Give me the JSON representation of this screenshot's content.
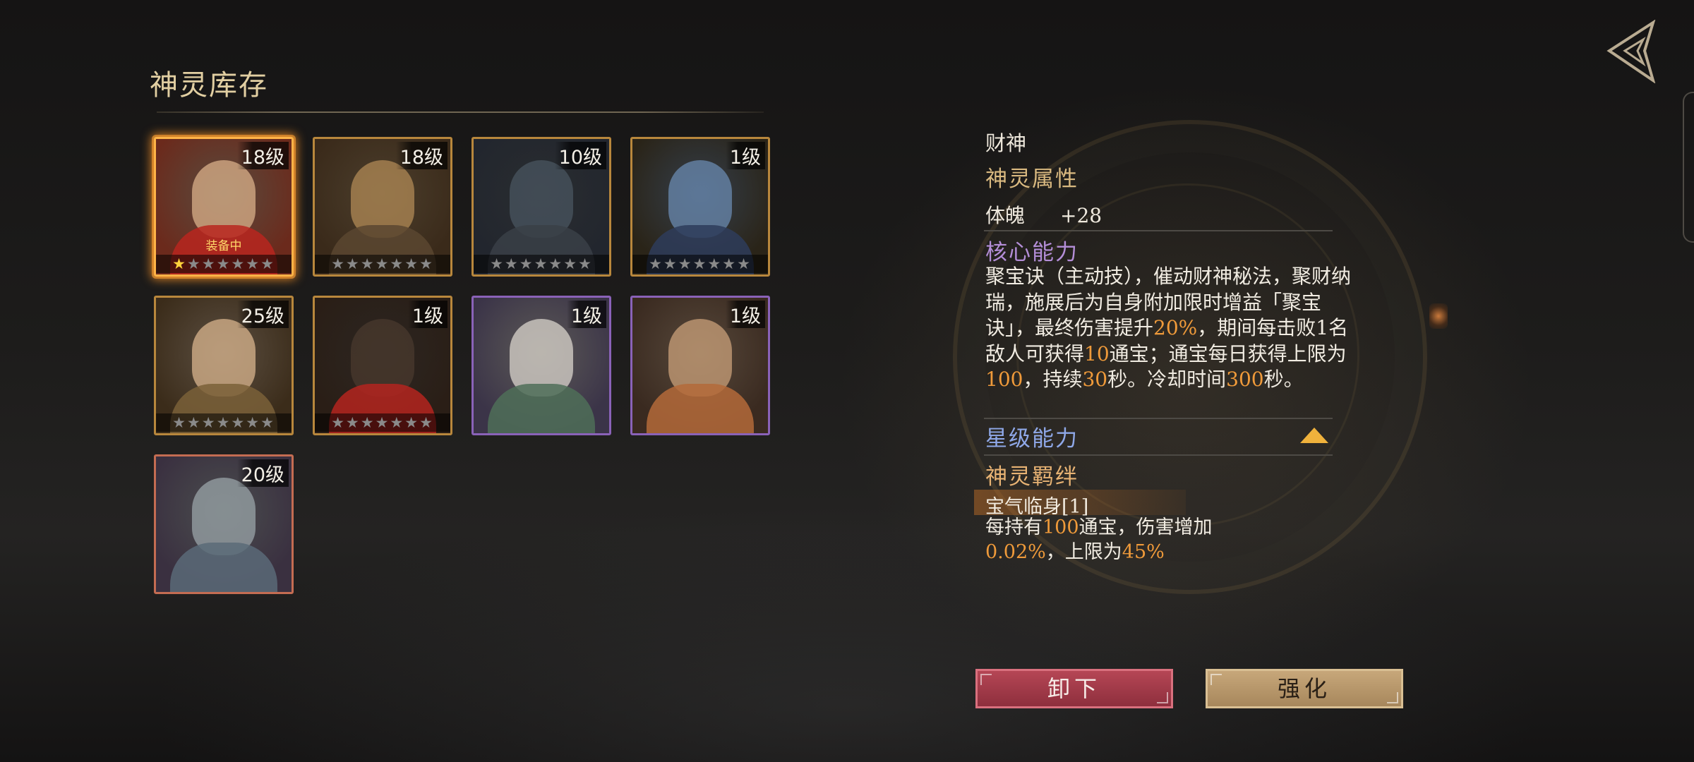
{
  "panel": {
    "title": "神灵库存"
  },
  "cards": [
    {
      "level": "18级",
      "stars_lit": 1,
      "stars_total": 7,
      "equipped": "装备中",
      "frame": "gold",
      "selected": true
    },
    {
      "level": "18级",
      "stars_lit": 0,
      "stars_total": 7,
      "equipped": "",
      "frame": "gold",
      "selected": false
    },
    {
      "level": "10级",
      "stars_lit": 0,
      "stars_total": 7,
      "equipped": "",
      "frame": "gold",
      "selected": false
    },
    {
      "level": "1级",
      "stars_lit": 0,
      "stars_total": 7,
      "equipped": "",
      "frame": "gold",
      "selected": false
    },
    {
      "level": "25级",
      "stars_lit": 0,
      "stars_total": 7,
      "equipped": "",
      "frame": "gold",
      "selected": false
    },
    {
      "level": "1级",
      "stars_lit": 0,
      "stars_total": 7,
      "equipped": "",
      "frame": "gold",
      "selected": false
    },
    {
      "level": "1级",
      "stars_lit": 0,
      "stars_total": 0,
      "equipped": "",
      "frame": "purple",
      "selected": false
    },
    {
      "level": "1级",
      "stars_lit": 0,
      "stars_total": 0,
      "equipped": "",
      "frame": "purple",
      "selected": false
    },
    {
      "level": "20级",
      "stars_lit": 0,
      "stars_total": 0,
      "equipped": "",
      "frame": "red",
      "selected": false
    }
  ],
  "detail": {
    "name": "财神",
    "attr_title": "神灵属性",
    "stat_label": "体魄",
    "stat_value": "+28",
    "core_title": "核心能力",
    "core_desc_parts": [
      {
        "t": "聚宝诀（主动技），催动财神秘法，聚财纳瑞，施展后为自身附加限时增益「聚宝诀」，最终伤害提升",
        "h": false
      },
      {
        "t": "20%",
        "h": true
      },
      {
        "t": "，期间每击败1名敌人可获得",
        "h": false
      },
      {
        "t": "10",
        "h": true
      },
      {
        "t": "通宝；通宝每日获得上限为",
        "h": false
      },
      {
        "t": "100",
        "h": true
      },
      {
        "t": "，持续",
        "h": false
      },
      {
        "t": "30",
        "h": true
      },
      {
        "t": "秒。冷却时间",
        "h": false
      },
      {
        "t": "300",
        "h": true
      },
      {
        "t": "秒。",
        "h": false
      }
    ],
    "star_title": "星级能力",
    "bond_title": "神灵羁绊",
    "bond_name": "宝气临身[1]",
    "bond_desc_parts": [
      {
        "t": "每持有",
        "h": false
      },
      {
        "t": "100",
        "h": true
      },
      {
        "t": "通宝，伤害增加",
        "h": false
      },
      {
        "t": "0.02%",
        "h": true
      },
      {
        "t": "，上限为",
        "h": false
      },
      {
        "t": "45%",
        "h": true
      }
    ]
  },
  "buttons": {
    "unequip": "卸下",
    "upgrade": "强化"
  },
  "colors": {
    "highlight": "#ef9a3a",
    "gold_title": "#d9b980",
    "core_title": "#b48ed8",
    "star_title": "#8fa8e8",
    "bond_title": "#e8b374"
  }
}
